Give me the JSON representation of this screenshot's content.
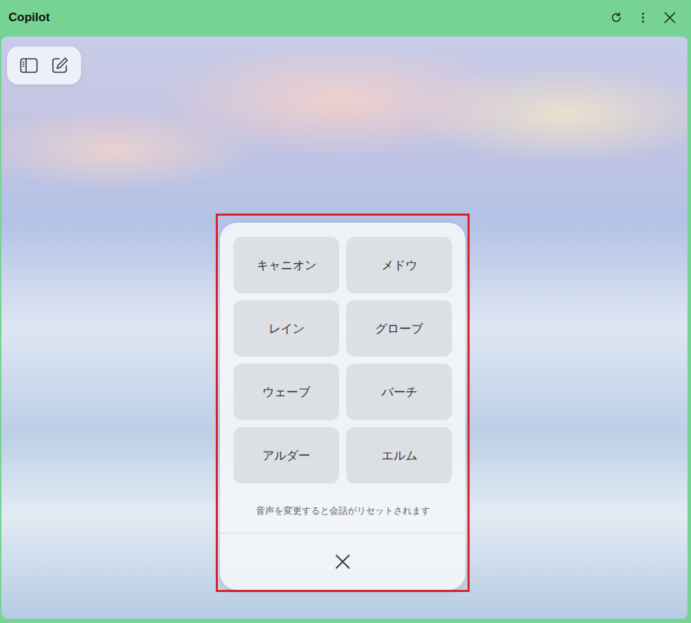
{
  "window": {
    "title": "Copilot"
  },
  "voice_picker": {
    "highlighted": true,
    "voices": [
      {
        "label": "キャニオン",
        "selected": false
      },
      {
        "label": "メドウ",
        "selected": false
      },
      {
        "label": "レイン",
        "selected": false
      },
      {
        "label": "グローブ",
        "selected": false
      },
      {
        "label": "ウェーブ",
        "selected": false
      },
      {
        "label": "バーチ",
        "selected": false
      },
      {
        "label": "アルダー",
        "selected": false
      },
      {
        "label": "エルム",
        "selected": false
      }
    ],
    "note": "音声を変更すると会話がリセットされます"
  }
}
